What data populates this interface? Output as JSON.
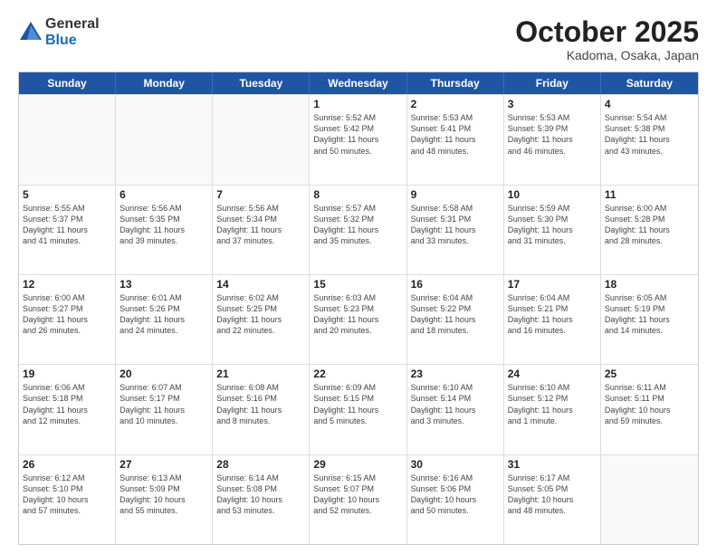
{
  "header": {
    "logo_general": "General",
    "logo_blue": "Blue",
    "month": "October 2025",
    "location": "Kadoma, Osaka, Japan"
  },
  "weekdays": [
    "Sunday",
    "Monday",
    "Tuesday",
    "Wednesday",
    "Thursday",
    "Friday",
    "Saturday"
  ],
  "rows": [
    [
      {
        "day": "",
        "info": ""
      },
      {
        "day": "",
        "info": ""
      },
      {
        "day": "",
        "info": ""
      },
      {
        "day": "1",
        "info": "Sunrise: 5:52 AM\nSunset: 5:42 PM\nDaylight: 11 hours\nand 50 minutes."
      },
      {
        "day": "2",
        "info": "Sunrise: 5:53 AM\nSunset: 5:41 PM\nDaylight: 11 hours\nand 48 minutes."
      },
      {
        "day": "3",
        "info": "Sunrise: 5:53 AM\nSunset: 5:39 PM\nDaylight: 11 hours\nand 46 minutes."
      },
      {
        "day": "4",
        "info": "Sunrise: 5:54 AM\nSunset: 5:38 PM\nDaylight: 11 hours\nand 43 minutes."
      }
    ],
    [
      {
        "day": "5",
        "info": "Sunrise: 5:55 AM\nSunset: 5:37 PM\nDaylight: 11 hours\nand 41 minutes."
      },
      {
        "day": "6",
        "info": "Sunrise: 5:56 AM\nSunset: 5:35 PM\nDaylight: 11 hours\nand 39 minutes."
      },
      {
        "day": "7",
        "info": "Sunrise: 5:56 AM\nSunset: 5:34 PM\nDaylight: 11 hours\nand 37 minutes."
      },
      {
        "day": "8",
        "info": "Sunrise: 5:57 AM\nSunset: 5:32 PM\nDaylight: 11 hours\nand 35 minutes."
      },
      {
        "day": "9",
        "info": "Sunrise: 5:58 AM\nSunset: 5:31 PM\nDaylight: 11 hours\nand 33 minutes."
      },
      {
        "day": "10",
        "info": "Sunrise: 5:59 AM\nSunset: 5:30 PM\nDaylight: 11 hours\nand 31 minutes."
      },
      {
        "day": "11",
        "info": "Sunrise: 6:00 AM\nSunset: 5:28 PM\nDaylight: 11 hours\nand 28 minutes."
      }
    ],
    [
      {
        "day": "12",
        "info": "Sunrise: 6:00 AM\nSunset: 5:27 PM\nDaylight: 11 hours\nand 26 minutes."
      },
      {
        "day": "13",
        "info": "Sunrise: 6:01 AM\nSunset: 5:26 PM\nDaylight: 11 hours\nand 24 minutes."
      },
      {
        "day": "14",
        "info": "Sunrise: 6:02 AM\nSunset: 5:25 PM\nDaylight: 11 hours\nand 22 minutes."
      },
      {
        "day": "15",
        "info": "Sunrise: 6:03 AM\nSunset: 5:23 PM\nDaylight: 11 hours\nand 20 minutes."
      },
      {
        "day": "16",
        "info": "Sunrise: 6:04 AM\nSunset: 5:22 PM\nDaylight: 11 hours\nand 18 minutes."
      },
      {
        "day": "17",
        "info": "Sunrise: 6:04 AM\nSunset: 5:21 PM\nDaylight: 11 hours\nand 16 minutes."
      },
      {
        "day": "18",
        "info": "Sunrise: 6:05 AM\nSunset: 5:19 PM\nDaylight: 11 hours\nand 14 minutes."
      }
    ],
    [
      {
        "day": "19",
        "info": "Sunrise: 6:06 AM\nSunset: 5:18 PM\nDaylight: 11 hours\nand 12 minutes."
      },
      {
        "day": "20",
        "info": "Sunrise: 6:07 AM\nSunset: 5:17 PM\nDaylight: 11 hours\nand 10 minutes."
      },
      {
        "day": "21",
        "info": "Sunrise: 6:08 AM\nSunset: 5:16 PM\nDaylight: 11 hours\nand 8 minutes."
      },
      {
        "day": "22",
        "info": "Sunrise: 6:09 AM\nSunset: 5:15 PM\nDaylight: 11 hours\nand 5 minutes."
      },
      {
        "day": "23",
        "info": "Sunrise: 6:10 AM\nSunset: 5:14 PM\nDaylight: 11 hours\nand 3 minutes."
      },
      {
        "day": "24",
        "info": "Sunrise: 6:10 AM\nSunset: 5:12 PM\nDaylight: 11 hours\nand 1 minute."
      },
      {
        "day": "25",
        "info": "Sunrise: 6:11 AM\nSunset: 5:11 PM\nDaylight: 10 hours\nand 59 minutes."
      }
    ],
    [
      {
        "day": "26",
        "info": "Sunrise: 6:12 AM\nSunset: 5:10 PM\nDaylight: 10 hours\nand 57 minutes."
      },
      {
        "day": "27",
        "info": "Sunrise: 6:13 AM\nSunset: 5:09 PM\nDaylight: 10 hours\nand 55 minutes."
      },
      {
        "day": "28",
        "info": "Sunrise: 6:14 AM\nSunset: 5:08 PM\nDaylight: 10 hours\nand 53 minutes."
      },
      {
        "day": "29",
        "info": "Sunrise: 6:15 AM\nSunset: 5:07 PM\nDaylight: 10 hours\nand 52 minutes."
      },
      {
        "day": "30",
        "info": "Sunrise: 6:16 AM\nSunset: 5:06 PM\nDaylight: 10 hours\nand 50 minutes."
      },
      {
        "day": "31",
        "info": "Sunrise: 6:17 AM\nSunset: 5:05 PM\nDaylight: 10 hours\nand 48 minutes."
      },
      {
        "day": "",
        "info": ""
      }
    ]
  ]
}
